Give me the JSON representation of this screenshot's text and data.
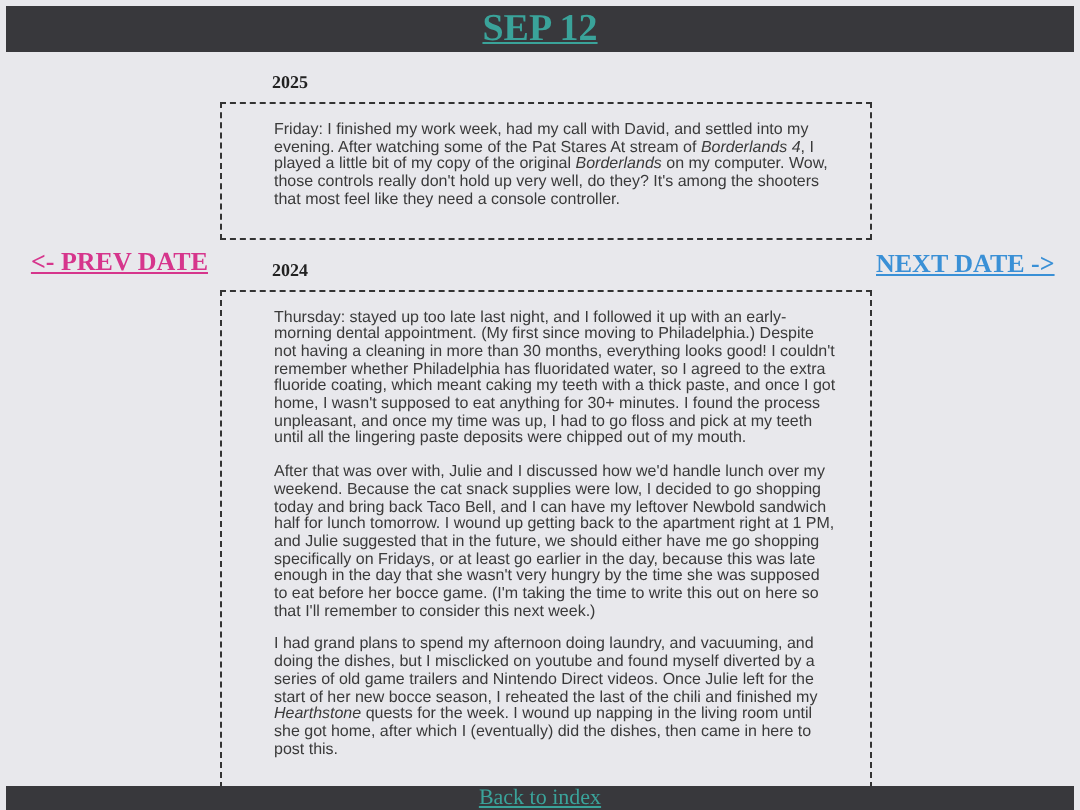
{
  "header": {
    "title": "SEP 12"
  },
  "nav": {
    "prev": "<- PREV DATE",
    "next": "NEXT DATE ->"
  },
  "entries": [
    {
      "year": "2025",
      "paragraphs": [
        "Friday: I finished my work week, had my call with David, and settled into my evening. After watching some of the Pat Stares At stream of *Borderlands 4*, I played a little bit of my copy of the original *Borderlands* on my computer. Wow, those controls really don't hold up very well, do they? It's among the shooters that most feel like they need a console controller."
      ]
    },
    {
      "year": "2024",
      "paragraphs": [
        "Thursday: stayed up too late last night, and I followed it up with an early-morning dental appointment. (My first since moving to Philadelphia.) Despite not having a cleaning in more than 30 months, everything looks good! I couldn't remember whether Philadelphia has fluoridated water, so I agreed to the extra fluoride coating, which meant caking my teeth with a thick paste, and once I got home, I wasn't supposed to eat anything for 30+ minutes. I found the process unpleasant, and once my time was up, I had to go floss and pick at my teeth until all the lingering paste deposits were chipped out of my mouth.",
        "After that was over with, Julie and I discussed how we'd handle lunch over my weekend. Because the cat snack supplies were low, I decided to go shopping today and bring back Taco Bell, and I can have my leftover Newbold sandwich half for lunch tomorrow. I wound up getting back to the apartment right at 1 PM, and Julie suggested that in the future, we should either have me go shopping specifically on Fridays, or at least go earlier in the day, because this was late enough in the day that she wasn't very hungry by the time she was supposed to eat before her bocce game. (I'm taking the time to write this out on here so that I'll remember to consider this next week.)",
        "I had grand plans to spend my afternoon doing laundry, and vacuuming, and doing the dishes, but I misclicked on youtube and found myself diverted by a series of old game trailers and Nintendo Direct videos. Once Julie left for the start of her new bocce season, I reheated the last of the chili and finished my *Hearthstone* quests for the week. I wound up napping in the living room until she got home, after which I (eventually) did the dishes, then came in here to post this."
      ]
    }
  ],
  "footer": {
    "link": "Back to index"
  }
}
